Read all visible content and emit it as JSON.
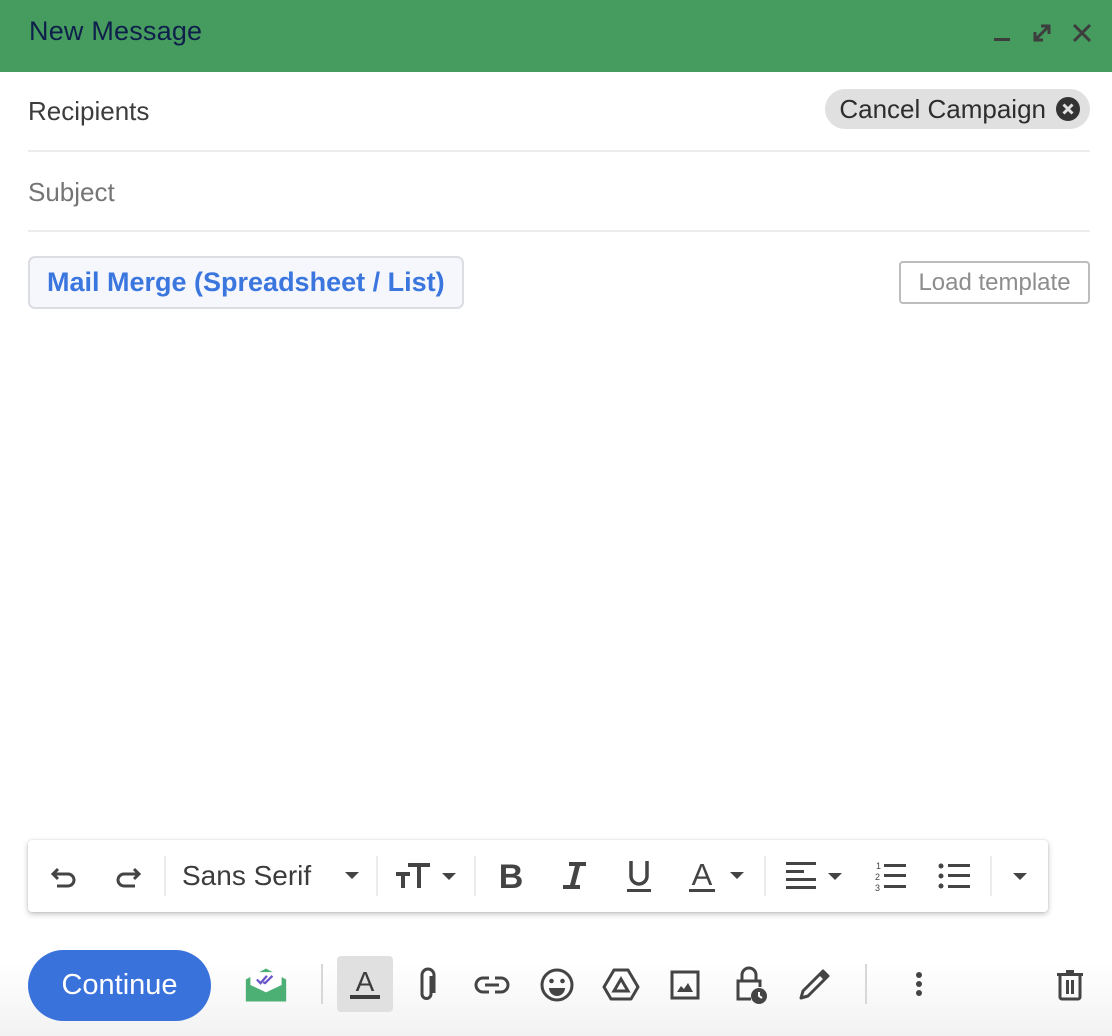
{
  "window": {
    "title": "New Message",
    "controls": [
      "minimize",
      "expand",
      "close"
    ],
    "header_color": "#469c5e"
  },
  "recipients": {
    "label": "Recipients",
    "chip_label": "Cancel Campaign"
  },
  "subject": {
    "value": "",
    "placeholder": "Subject"
  },
  "actions": {
    "mail_merge_label": "Mail Merge (Spreadsheet / List)",
    "load_template_label": "Load template"
  },
  "body": {
    "value": ""
  },
  "formatting_toolbar": {
    "font_family": "Sans Serif",
    "buttons": [
      "undo",
      "redo",
      "font-family",
      "font-size",
      "bold",
      "italic",
      "underline",
      "text-color",
      "align",
      "numbered-list",
      "bulleted-list",
      "more-formatting"
    ]
  },
  "bottom_toolbar": {
    "send_label": "Continue",
    "send_color": "#3a72dc",
    "icons": [
      "tracking-envelope",
      "formatting-options",
      "attach-files",
      "insert-link",
      "insert-emoji",
      "insert-drive",
      "insert-photo",
      "confidential-mode",
      "insert-signature",
      "more-options",
      "discard-draft"
    ]
  }
}
